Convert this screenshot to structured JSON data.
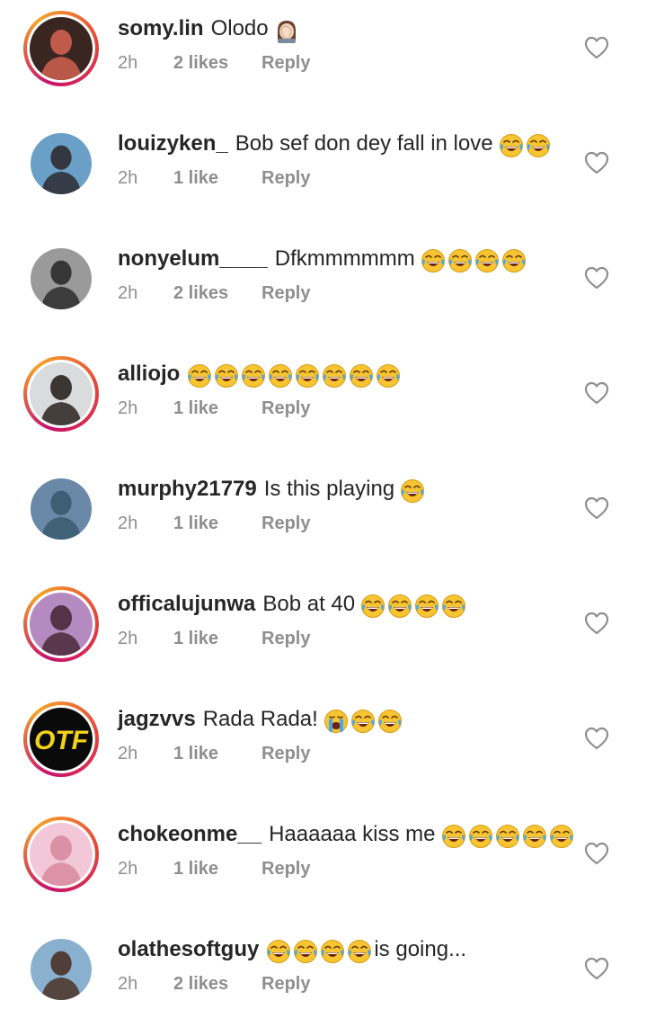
{
  "comments": [
    {
      "username": "somy.lin",
      "text": "Olodo",
      "emoji_after": [
        "woman-facepalming"
      ],
      "time": "2h",
      "likes": "2 likes",
      "reply": "Reply",
      "story_ring": true,
      "avatar_colors": [
        "#3a2620",
        "#d06050"
      ]
    },
    {
      "username": "louizyken_",
      "text": "Bob sef don dey fall in love",
      "emoji_after": [
        "face-with-tears-of-joy",
        "face-with-tears-of-joy"
      ],
      "time": "2h",
      "likes": "1 like",
      "reply": "Reply",
      "story_ring": false,
      "avatar_colors": [
        "#6aa0c8",
        "#2d2a30"
      ]
    },
    {
      "username": "nonyelum____",
      "text": "Dfkmmmmmm",
      "emoji_after": [
        "face-with-tears-of-joy",
        "face-with-tears-of-joy",
        "face-with-tears-of-joy",
        "face-with-tears-of-joy"
      ],
      "time": "2h",
      "likes": "2 likes",
      "reply": "Reply",
      "story_ring": false,
      "avatar_colors": [
        "#9a9a9a",
        "#2b2b2b"
      ]
    },
    {
      "username": "alliojo",
      "text": "",
      "emoji_after": [
        "face-with-tears-of-joy",
        "face-with-tears-of-joy",
        "face-with-tears-of-joy",
        "face-with-tears-of-joy",
        "face-with-tears-of-joy",
        "face-with-tears-of-joy",
        "face-with-tears-of-joy",
        "face-with-tears-of-joy"
      ],
      "time": "2h",
      "likes": "1 like",
      "reply": "Reply",
      "story_ring": true,
      "avatar_colors": [
        "#d9dbdc",
        "#2a2320"
      ]
    },
    {
      "username": "murphy21779",
      "text": "Is this playing",
      "emoji_after": [
        "face-with-tears-of-joy"
      ],
      "time": "2h",
      "likes": "1 like",
      "reply": "Reply",
      "story_ring": false,
      "avatar_colors": [
        "#6a88a8",
        "#3a5a70"
      ]
    },
    {
      "username": "officalujunwa",
      "text": "Bob at 40",
      "emoji_after": [
        "face-with-tears-of-joy",
        "face-with-tears-of-joy",
        "face-with-tears-of-joy",
        "face-with-tears-of-joy"
      ],
      "time": "2h",
      "likes": "1 like",
      "reply": "Reply",
      "story_ring": true,
      "avatar_colors": [
        "#b48ac0",
        "#4a2838"
      ]
    },
    {
      "username": "jagzvvs",
      "text": "Rada Rada!",
      "emoji_after": [
        "loudly-crying-face",
        "face-with-tears-of-joy",
        "face-with-tears-of-joy"
      ],
      "time": "2h",
      "likes": "1 like",
      "reply": "Reply",
      "story_ring": true,
      "avatar_colors": [
        "#0a0a0a",
        "#f2d21a"
      ],
      "avatar_text": "OTF"
    },
    {
      "username": "chokeonme__",
      "text": "Haaaaaa kiss me",
      "emoji_after": [
        "face-with-tears-of-joy",
        "face-with-tears-of-joy",
        "face-with-tears-of-joy",
        "face-with-tears-of-joy",
        "face-with-tears-of-joy"
      ],
      "time": "2h",
      "likes": "1 like",
      "reply": "Reply",
      "story_ring": true,
      "avatar_colors": [
        "#f2c8d8",
        "#d88aa0"
      ]
    },
    {
      "username": "olathesoftguy",
      "text": "",
      "emoji_after": [
        "face-with-tears-of-joy",
        "face-with-tears-of-joy",
        "face-with-tears-of-joy",
        "face-with-tears-of-joy"
      ],
      "text_after": "is going...",
      "time": "2h",
      "likes": "2 likes",
      "reply": "Reply",
      "story_ring": false,
      "avatar_colors": [
        "#8ab0d0",
        "#4a3226"
      ]
    }
  ],
  "colors": {
    "text": "#262626",
    "meta": "#8e8e8e",
    "heart_stroke": "#8e8e8e"
  },
  "icons": {
    "like": "heart-outline-icon"
  }
}
